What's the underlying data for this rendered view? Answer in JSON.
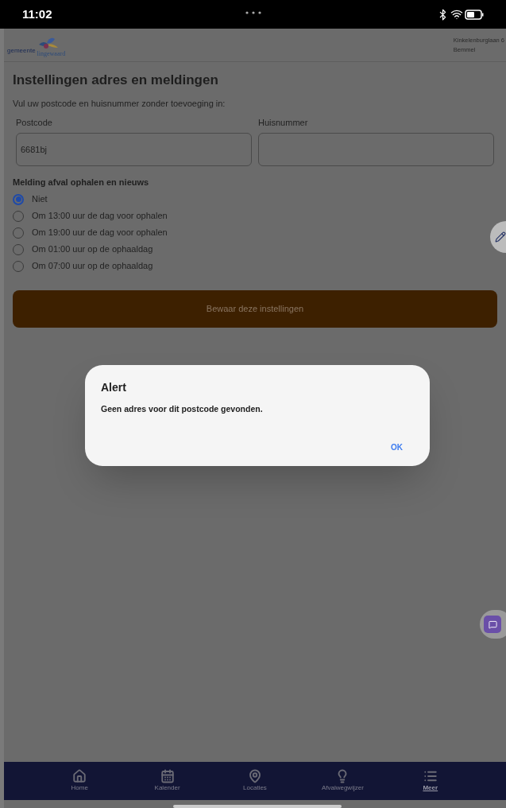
{
  "status_bar": {
    "time": "11:02"
  },
  "header": {
    "logo_small": "gemeente",
    "logo_name": "lingewaard",
    "address_line_1": "Kinkelenburglaan 6",
    "address_line_2": "Bemmel"
  },
  "title": "Instellingen adres en meldingen",
  "instruction": "Vul uw postcode en huisnummer zonder toevoeging in:",
  "fields": [
    {
      "label": "Postcode",
      "value": "6681bj"
    },
    {
      "label": "Huisnummer"
    }
  ],
  "notifications": {
    "label": "Melding afval ophalen en nieuws",
    "options": [
      {
        "label": "Niet",
        "selected": true
      },
      {
        "label": "Om 13:00 uur de dag voor ophalen",
        "selected": false
      },
      {
        "label": "Om 19:00 uur de dag voor ophalen",
        "selected": false
      },
      {
        "label": "Om 01:00 uur op de ophaaldag",
        "selected": false
      },
      {
        "label": "Om 07:00 uur op de ophaaldag",
        "selected": false
      }
    ]
  },
  "save_button": "Bewaar deze instellingen",
  "dialog": {
    "title": "Alert",
    "message": "Geen adres voor dit postcode gevonden.",
    "button": "OK"
  },
  "bottom_nav": [
    {
      "label": "Home",
      "selected": false
    },
    {
      "label": "Kalender",
      "selected": false
    },
    {
      "label": "Locaties",
      "selected": false
    },
    {
      "label": "Afvalwegwijzer",
      "selected": false
    },
    {
      "label": "Meer",
      "selected": true
    }
  ]
}
